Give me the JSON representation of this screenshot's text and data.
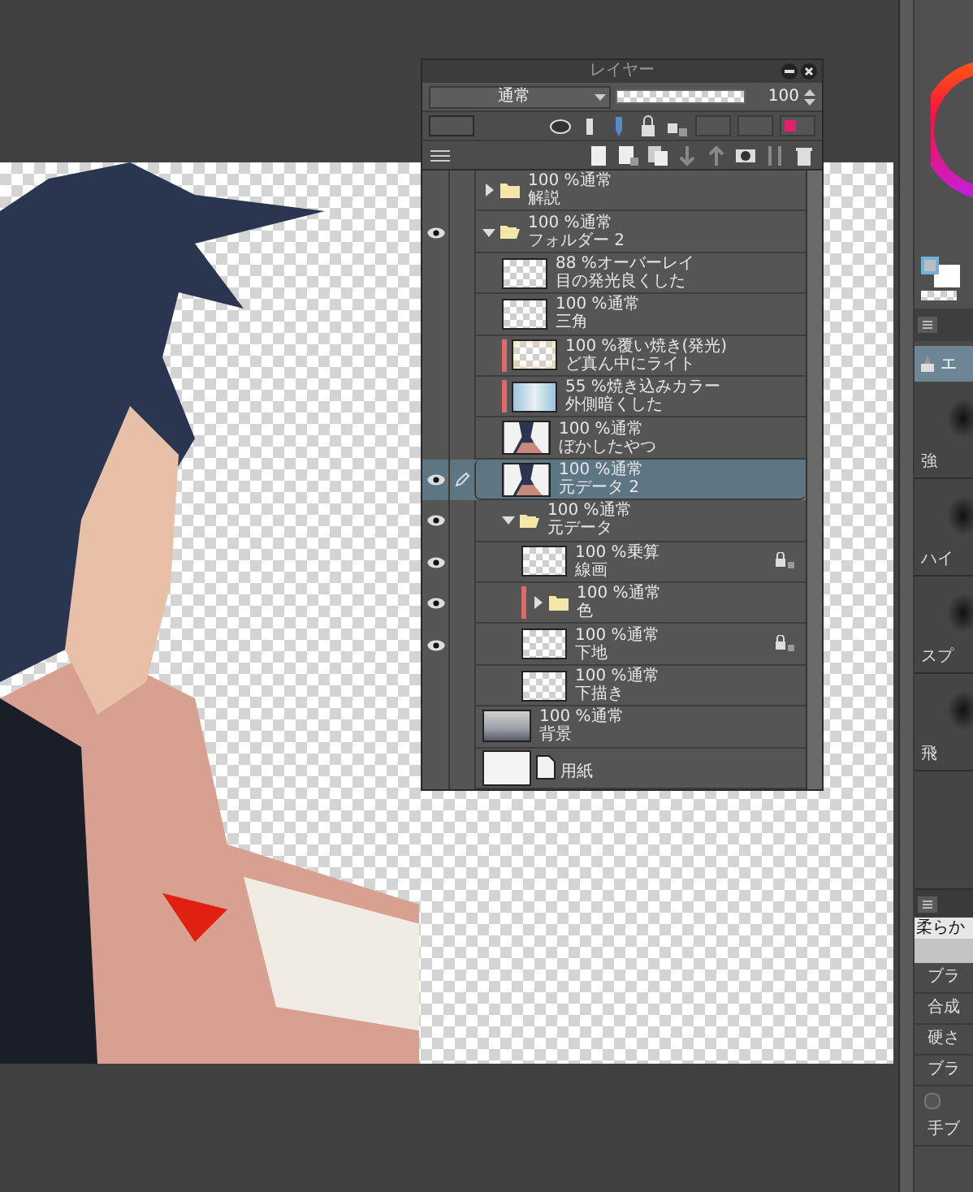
{
  "panel": {
    "title": "レイヤー",
    "blend_mode": "通常",
    "opacity": "100",
    "opacity_slider": {
      "level": 1
    }
  },
  "layers": [
    {
      "kind": "folder",
      "mode": "100 %通常",
      "name": "解説",
      "visible": false,
      "expanded": false,
      "selected": false,
      "clipped": false,
      "locked": false
    },
    {
      "kind": "folder",
      "mode": "100 %通常",
      "name": "フォルダー 2",
      "visible": true,
      "expanded": true,
      "selected": false,
      "clipped": false,
      "locked": false,
      "children": [
        {
          "kind": "transparent",
          "mode": "88 %オーバーレイ",
          "name": "目の発光良くした",
          "visible": false,
          "selected": false,
          "clipped": false,
          "locked": false
        },
        {
          "kind": "transparent",
          "mode": "100 %通常",
          "name": "三角",
          "visible": false,
          "selected": false,
          "clipped": false,
          "locked": false
        },
        {
          "kind": "glow",
          "mode": "100 %覆い焼き(発光)",
          "name": "ど真ん中にライト",
          "visible": false,
          "selected": false,
          "clipped": true,
          "locked": false
        },
        {
          "kind": "tint",
          "mode": "55 %焼き込みカラー",
          "name": "外側暗くした",
          "visible": false,
          "selected": false,
          "clipped": true,
          "locked": false
        },
        {
          "kind": "figure",
          "mode": "100 %通常",
          "name": "ぼかしたやつ",
          "visible": false,
          "selected": false,
          "clipped": false,
          "locked": false
        },
        {
          "kind": "figure",
          "mode": "100 %通常",
          "name": "元データ 2",
          "visible": true,
          "selected": true,
          "clipped": false,
          "locked": false
        },
        {
          "kind": "folder",
          "mode": "100 %通常",
          "name": "元データ",
          "visible": true,
          "expanded": true,
          "selected": false,
          "clipped": false,
          "locked": false,
          "children": [
            {
              "kind": "transparent",
              "mode": "100 %乗算",
              "name": "線画",
              "visible": true,
              "selected": false,
              "clipped": false,
              "locked": true
            },
            {
              "kind": "folder",
              "mode": "100 %通常",
              "name": "色",
              "visible": true,
              "expanded": false,
              "selected": false,
              "clipped": true,
              "locked": false
            },
            {
              "kind": "transparent",
              "mode": "100 %通常",
              "name": "下地",
              "visible": true,
              "selected": false,
              "clipped": false,
              "locked": true
            },
            {
              "kind": "transparent",
              "mode": "100 %通常",
              "name": "下描き",
              "visible": false,
              "selected": false,
              "clipped": false,
              "locked": false
            }
          ]
        }
      ]
    },
    {
      "kind": "gradient",
      "mode": "100 %通常",
      "name": "背景",
      "visible": false,
      "selected": false,
      "clipped": false,
      "locked": false
    },
    {
      "kind": "paper",
      "name": "用紙",
      "visible": false,
      "selected": false,
      "clipped": false,
      "locked": false
    }
  ],
  "right_panel": {
    "tool_tab": "エ",
    "brushes": [
      "強",
      "ハイ",
      "スプ",
      "飛"
    ],
    "sub_tool": "柔らか",
    "properties": [
      {
        "kind": "label",
        "text": "ブラ"
      },
      {
        "kind": "label",
        "text": "合成"
      },
      {
        "kind": "label",
        "text": "硬さ"
      },
      {
        "kind": "label",
        "text": "ブラ"
      },
      {
        "kind": "checkbox",
        "checked": false
      },
      {
        "kind": "label",
        "text": "手ブ"
      }
    ]
  }
}
